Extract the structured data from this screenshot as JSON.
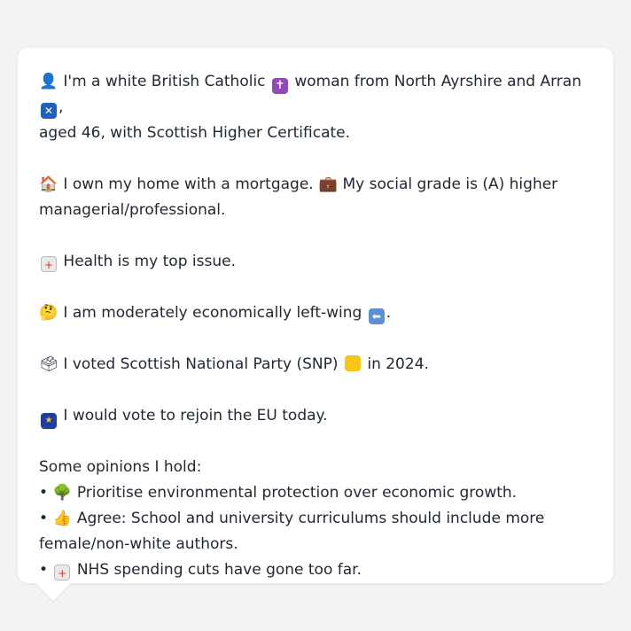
{
  "profile": {
    "line1a": "I'm a white British Catholic",
    "line1b": "woman from North Ayrshire and Arran",
    "line1c": ",",
    "line2": "aged 46, with Scottish Higher Certificate.",
    "line3a": "I own my home with a mortgage.",
    "line3b": "My social grade is (A) higher",
    "line4": "managerial/professional.",
    "line5": "Health is my top issue.",
    "line6a": "I am moderately economically left-wing",
    "line6b": ".",
    "line7a": "I voted Scottish National Party (SNP)",
    "line7b": "in 2024.",
    "line8": "I would vote to rejoin the EU today."
  },
  "opinions": {
    "heading": "Some opinions I hold:",
    "bullet": "•",
    "items": [
      "Prioritise environmental protection over economic growth.",
      "Agree: School and university curriculums should include more",
      "female/non-white authors.",
      "NHS spending cuts have gone too far."
    ]
  },
  "icons": {
    "person": "person-icon",
    "cross": "latin-cross-icon",
    "scotland": "scotland-flag-icon",
    "house": "house-icon",
    "briefcase": "briefcase-icon",
    "hospital": "hospital-icon",
    "thinking": "thinking-face-icon",
    "left_arrow": "left-arrow-icon",
    "ballot": "ballot-box-icon",
    "snp_square": "yellow-square-icon",
    "eu": "eu-flag-icon",
    "tree": "tree-icon",
    "thumbs_up": "thumbs-up-icon"
  },
  "colors": {
    "background": "#f2f3f5",
    "card": "#ffffff",
    "text": "#1f2733"
  }
}
